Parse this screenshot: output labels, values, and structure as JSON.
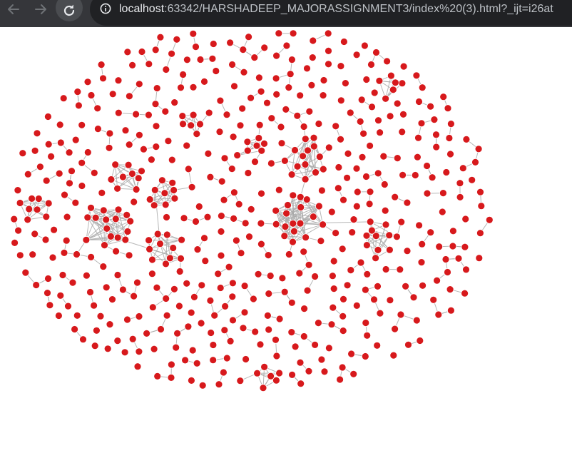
{
  "browser": {
    "url_host": "localhost",
    "url_rest": ":63342/HARSHADEEP_MAJORASSIGNMENT3/index%20(3).html?_ijt=i26at",
    "icons": {
      "back": "arrow-left-icon",
      "forward": "arrow-right-icon",
      "reload": "reload-icon",
      "site_info": "info-circle-icon"
    }
  },
  "graph": {
    "node_color": "#d7191c",
    "link_color": "#aaaaaa"
  }
}
